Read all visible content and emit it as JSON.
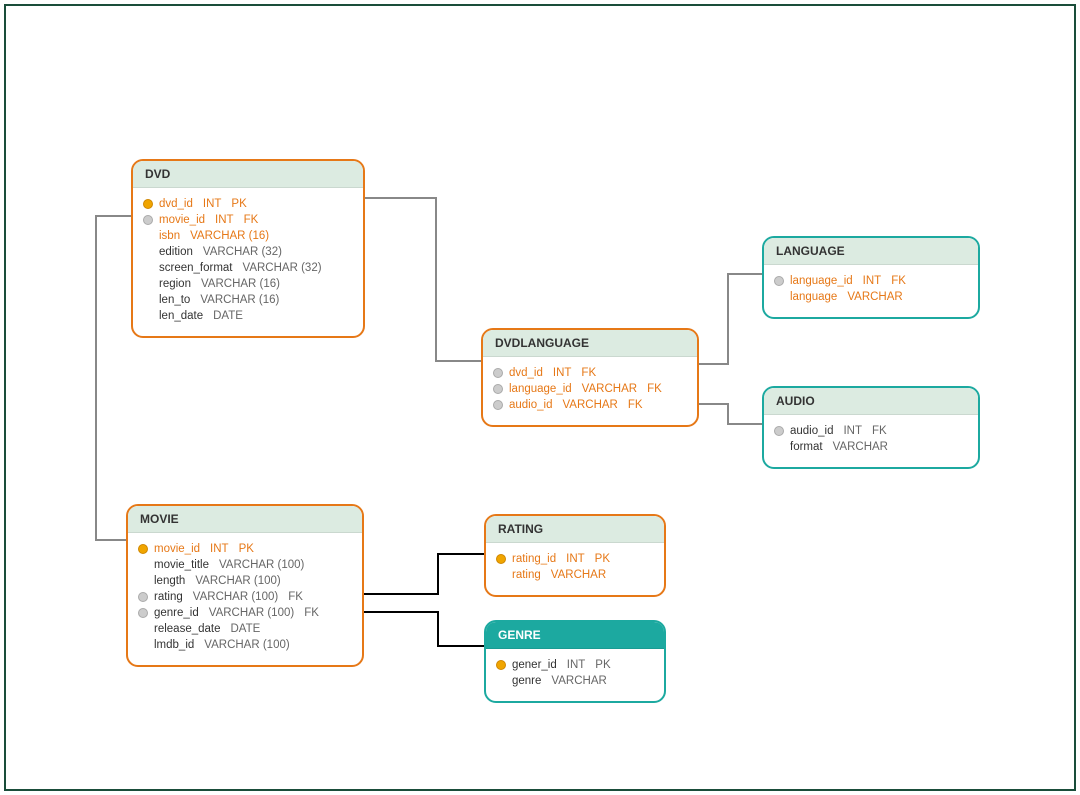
{
  "entities": {
    "dvd": {
      "title": "DVD",
      "columns": [
        {
          "key": "pk",
          "name": "dvd_id",
          "type": "INT",
          "constraint": "PK",
          "hl": true
        },
        {
          "key": "fk",
          "name": "movie_id",
          "type": "INT",
          "constraint": "FK",
          "hl": true
        },
        {
          "key": "none",
          "name": "isbn",
          "type": "VARCHAR (16)",
          "constraint": "",
          "hl": true
        },
        {
          "key": "none",
          "name": "edition",
          "type": "VARCHAR (32)",
          "constraint": "",
          "hl": false
        },
        {
          "key": "none",
          "name": "screen_format",
          "type": "VARCHAR (32)",
          "constraint": "",
          "hl": false
        },
        {
          "key": "none",
          "name": "region",
          "type": "VARCHAR (16)",
          "constraint": "",
          "hl": false
        },
        {
          "key": "none",
          "name": "len_to",
          "type": "VARCHAR (16)",
          "constraint": "",
          "hl": false
        },
        {
          "key": "none",
          "name": "len_date",
          "type": "DATE",
          "constraint": "",
          "hl": false
        }
      ]
    },
    "dvdlanguage": {
      "title": "DVDLANGUAGE",
      "columns": [
        {
          "key": "fk",
          "name": "dvd_id",
          "type": "INT",
          "constraint": "FK",
          "hl": true
        },
        {
          "key": "fk",
          "name": "language_id",
          "type": "VARCHAR",
          "constraint": "FK",
          "hl": true
        },
        {
          "key": "fk",
          "name": "audio_id",
          "type": "VARCHAR",
          "constraint": "FK",
          "hl": true
        }
      ]
    },
    "language": {
      "title": "LANGUAGE",
      "columns": [
        {
          "key": "fk",
          "name": "language_id",
          "type": "INT",
          "constraint": "FK",
          "hl": true
        },
        {
          "key": "none",
          "name": "language",
          "type": "VARCHAR",
          "constraint": "",
          "hl": true
        }
      ]
    },
    "audio": {
      "title": "AUDIO",
      "columns": [
        {
          "key": "fk",
          "name": "audio_id",
          "type": "INT",
          "constraint": "FK",
          "hl": false
        },
        {
          "key": "none",
          "name": "format",
          "type": "VARCHAR",
          "constraint": "",
          "hl": false
        }
      ]
    },
    "movie": {
      "title": "MOVIE",
      "columns": [
        {
          "key": "pk",
          "name": "movie_id",
          "type": "INT",
          "constraint": "PK",
          "hl": true
        },
        {
          "key": "none",
          "name": "movie_title",
          "type": "VARCHAR (100)",
          "constraint": "",
          "hl": false
        },
        {
          "key": "none",
          "name": "length",
          "type": "VARCHAR (100)",
          "constraint": "",
          "hl": false
        },
        {
          "key": "fk",
          "name": "rating",
          "type": "VARCHAR (100)",
          "constraint": "FK",
          "hl": false
        },
        {
          "key": "fk",
          "name": "genre_id",
          "type": "VARCHAR (100)",
          "constraint": "FK",
          "hl": false
        },
        {
          "key": "none",
          "name": "release_date",
          "type": "DATE",
          "constraint": "",
          "hl": false
        },
        {
          "key": "none",
          "name": "lmdb_id",
          "type": "VARCHAR (100)",
          "constraint": "",
          "hl": false
        }
      ]
    },
    "rating": {
      "title": "RATING",
      "columns": [
        {
          "key": "pk",
          "name": "rating_id",
          "type": "INT",
          "constraint": "PK",
          "hl": true
        },
        {
          "key": "none",
          "name": "rating",
          "type": "VARCHAR",
          "constraint": "",
          "hl": true
        }
      ]
    },
    "genre": {
      "title": "GENRE",
      "columns": [
        {
          "key": "pk",
          "name": "gener_id",
          "type": "INT",
          "constraint": "PK",
          "hl": false
        },
        {
          "key": "none",
          "name": "genre",
          "type": "VARCHAR",
          "constraint": "",
          "hl": false
        }
      ]
    }
  }
}
